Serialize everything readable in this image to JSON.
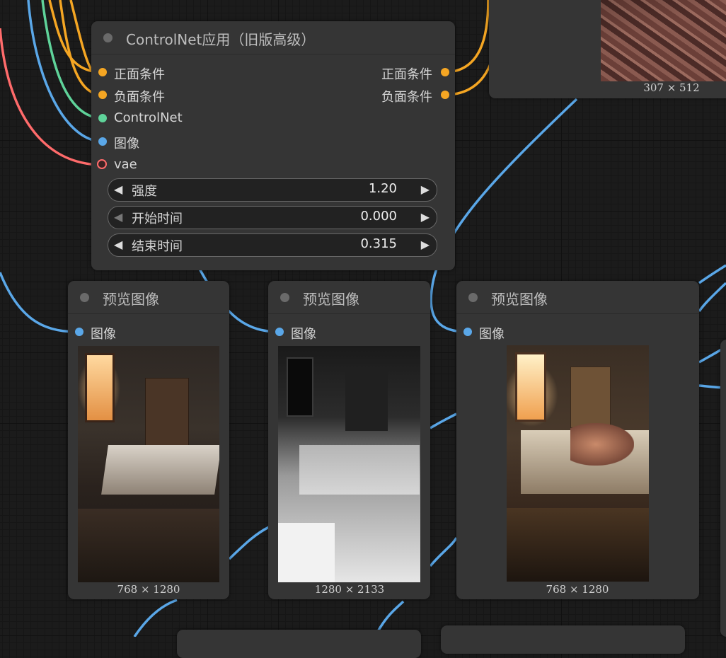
{
  "controlnet_node": {
    "title": "ControlNet应用（旧版高级）",
    "inputs": [
      {
        "label": "正面条件",
        "color": "#f5a623"
      },
      {
        "label": "负面条件",
        "color": "#f5a623"
      },
      {
        "label": "ControlNet",
        "color": "#5fd39a"
      },
      {
        "label": "图像",
        "color": "#5aa7e8"
      },
      {
        "label": "vae",
        "color": "#ff6b6b"
      }
    ],
    "outputs": [
      {
        "label": "正面条件",
        "color": "#f5a623"
      },
      {
        "label": "负面条件",
        "color": "#f5a623"
      }
    ],
    "widgets": [
      {
        "label": "强度",
        "value": "1.20"
      },
      {
        "label": "开始时间",
        "value": "0.000"
      },
      {
        "label": "结束时间",
        "value": "0.315"
      }
    ]
  },
  "top_preview": {
    "size_label": "307 × 512"
  },
  "preview_nodes": [
    {
      "title": "预览图像",
      "input_label": "图像",
      "size_label": "768 × 1280",
      "image": "sunlit messy bedroom render"
    },
    {
      "title": "预览图像",
      "input_label": "图像",
      "size_label": "1280 × 2133",
      "image": "grayscale depth map of bedroom"
    },
    {
      "title": "预览图像",
      "input_label": "图像",
      "size_label": "768 × 1280",
      "image": "anime bedroom render"
    }
  ],
  "colors": {
    "background": "#1b1b1b",
    "node_body": "#353535",
    "link_image": "#5aa7e8",
    "link_conditioning": "#f5a623",
    "link_controlnet": "#5fd39a",
    "link_vae": "#ff6b6b"
  }
}
